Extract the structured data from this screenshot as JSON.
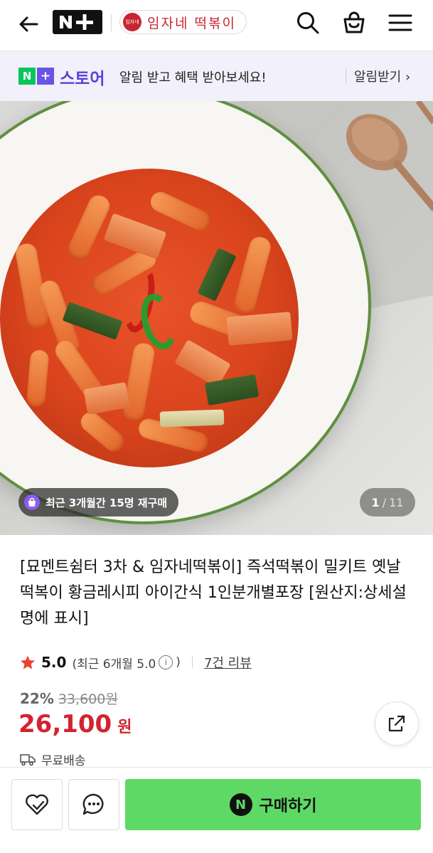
{
  "header": {
    "brand_badge": "N+",
    "store_name": "임자네 떡볶이",
    "store_logo_text": "임자네"
  },
  "banner": {
    "badge_n": "N",
    "badge_plus": "+",
    "store_label": "스토어",
    "message": "알림 받고 혜택 받아보세요!",
    "cta": "알림받기 ›"
  },
  "hero": {
    "repurchase_text": "최근 3개월간 15명 재구매",
    "counter_current": "1",
    "counter_sep": "/",
    "counter_total": "11"
  },
  "product": {
    "title": "[묘멘트쉼터 3차 & 임자네떡볶이] 즉석떡볶이 밀키트 옛날 떡복이 황금레시피 아이간식 1인분개별포장 [원산지:상세설명에 표시]",
    "rating": "5.0",
    "recent_rating": "(최근 6개월 5.0",
    "recent_close": ")",
    "reviews": "7건 리뷰",
    "discount_pct": "22%",
    "original_price": "33,600원",
    "price": "26,100",
    "currency": "원",
    "shipping": "무료배송"
  },
  "bottom": {
    "buy_label": "구매하기",
    "buy_logo": "N"
  },
  "colors": {
    "accent_red": "#d4232f",
    "buy_green": "#5fd965",
    "store_purple": "#5b41d8",
    "naver_green": "#03c75a"
  }
}
